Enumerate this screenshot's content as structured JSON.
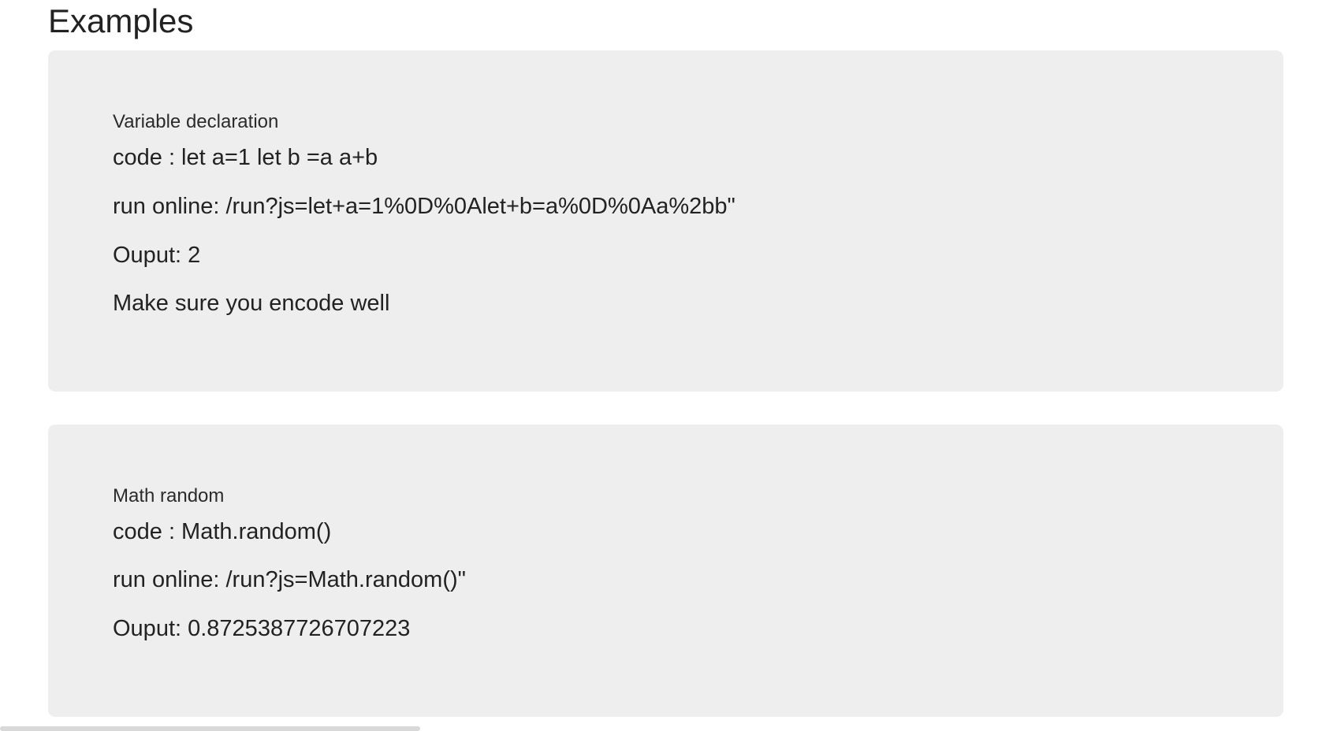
{
  "page": {
    "heading": "Examples"
  },
  "examples": [
    {
      "title": "Variable declaration",
      "code_line": "code : let a=1 let b =a a+b",
      "run_line": "run online: /run?js=let+a=1%0D%0Alet+b=a%0D%0Aa%2bb\"",
      "output_line": "Ouput: 2",
      "note": "Make sure you encode well"
    },
    {
      "title": "Math random",
      "code_line": "code : Math.random()",
      "run_line": "run online: /run?js=Math.random()\"",
      "output_line": "Ouput: 0.8725387726707223"
    }
  ],
  "colors": {
    "card_background": "#eeeeee",
    "text": "#222222",
    "scrollbar_thumb": "#d8d8d8"
  }
}
